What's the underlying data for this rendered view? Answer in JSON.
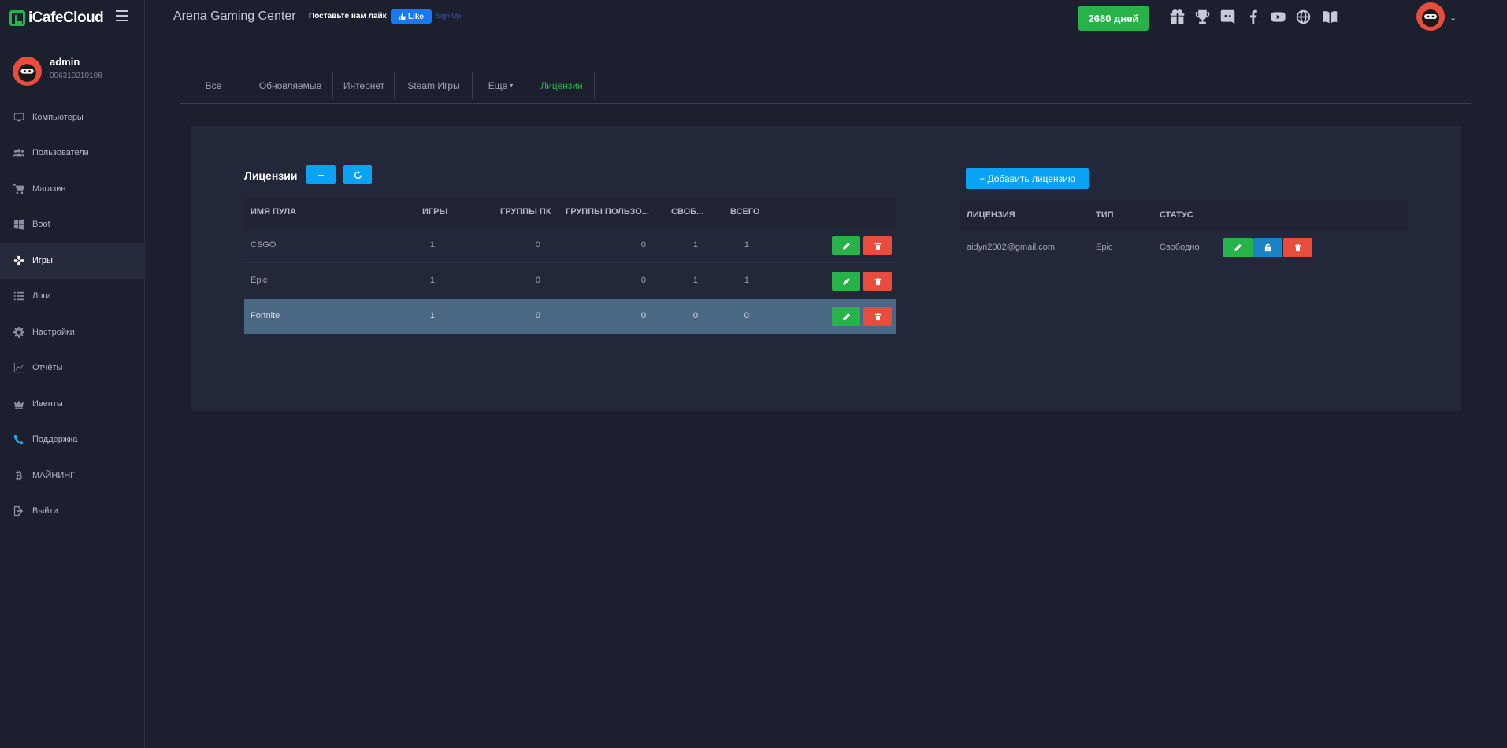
{
  "header": {
    "logo_text": "iCafeCloud",
    "cafe_name": "Arena Gaming Center",
    "like_prompt": "Поставьте нам лайк",
    "fb_like_label": "Like",
    "fb_signup_label": "Sign Up",
    "days_badge": "2680 дней",
    "icons": [
      "gift-icon",
      "trophy-icon",
      "discord-icon",
      "facebook-icon",
      "youtube-icon",
      "globe-icon",
      "book-icon"
    ]
  },
  "user": {
    "name": "admin",
    "id": "006310210108"
  },
  "sidebar": {
    "items": [
      {
        "label": "Компьютеры",
        "icon": "monitor-icon"
      },
      {
        "label": "Пользователи",
        "icon": "users-icon"
      },
      {
        "label": "Магазин",
        "icon": "cart-icon"
      },
      {
        "label": "Boot",
        "icon": "windows-icon"
      },
      {
        "label": "Игры",
        "icon": "gamepad-icon",
        "active": true
      },
      {
        "label": "Логи",
        "icon": "list-icon"
      },
      {
        "label": "Настройки",
        "icon": "gear-icon"
      },
      {
        "label": "Отчёты",
        "icon": "chart-line-icon"
      },
      {
        "label": "Ивенты",
        "icon": "crown-icon"
      },
      {
        "label": "Поддержка",
        "icon": "phone-icon"
      },
      {
        "label": "МАЙНИНГ",
        "icon": "bitcoin-icon"
      },
      {
        "label": "Выйти",
        "icon": "logout-icon"
      }
    ]
  },
  "tabs": [
    {
      "label": "Все"
    },
    {
      "label": "Обновляемые"
    },
    {
      "label": "Интернет"
    },
    {
      "label": "Steam Игры"
    },
    {
      "label": "Еще"
    },
    {
      "label": "Лицензии",
      "active": true
    }
  ],
  "pools": {
    "title": "Лицензии",
    "add_label": "+",
    "columns": [
      "ИМЯ ПУЛА",
      "ИГРЫ",
      "ГРУППЫ ПК",
      "ГРУППЫ ПОЛЬЗО...",
      "СВОБ...",
      "ВСЕГО"
    ],
    "rows": [
      {
        "name": "CSGO",
        "games": "1",
        "pc_groups": "0",
        "user_groups": "0",
        "free": "1",
        "total": "1"
      },
      {
        "name": "Epic",
        "games": "1",
        "pc_groups": "0",
        "user_groups": "0",
        "free": "1",
        "total": "1"
      },
      {
        "name": "Fortnite",
        "games": "1",
        "pc_groups": "0",
        "user_groups": "0",
        "free": "0",
        "total": "0",
        "selected": true
      }
    ]
  },
  "licenses": {
    "add_button": "+ Добавить лицензию",
    "columns": [
      "ЛИЦЕНЗИЯ",
      "ТИП",
      "СТАТУС"
    ],
    "rows": [
      {
        "license": "aidyn2002@gmail.com",
        "type": "Epic",
        "status": "Свободно"
      }
    ]
  },
  "colors": {
    "accent_green": "#27b34a",
    "accent_blue": "#0aa2f5",
    "danger_red": "#e74c3c",
    "selected_row": "#4a6884"
  }
}
